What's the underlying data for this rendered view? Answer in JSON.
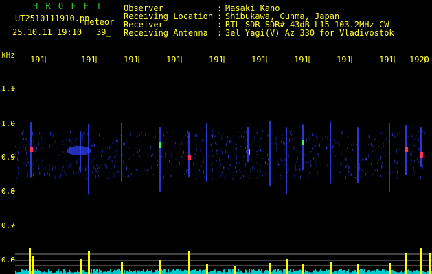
{
  "header": {
    "brand": "H R O F F T",
    "filename": "UT2510111910.pn",
    "suffix": "meteor",
    "datetime": "25.10.11 19:10",
    "number": "39_",
    "fields": [
      {
        "label": "Observer",
        "value": "Masaki Kano"
      },
      {
        "label": "Receiving Location",
        "value": "Shibukawa, Gunma, Japan"
      },
      {
        "label": "Receiver",
        "value": "RTL-SDR SDR# 43dB L15 103.2MHz CW"
      },
      {
        "label": "Receiving Antenna",
        "value": "3el Yagi(V) Az 330 for Vladivostok"
      }
    ],
    "colon": ":"
  },
  "axis": {
    "unit": "kHz",
    "y_ticks": [
      "1.1",
      "1.0",
      "0.9",
      "0.8",
      "0.7",
      "0.6"
    ],
    "x_ticks": [
      "191",
      "191",
      "191",
      "191",
      "191",
      "191",
      "191",
      "191",
      "191",
      "1920"
    ]
  },
  "colors": {
    "text_yellow": "#ffff33",
    "brand_green": "#33cc33",
    "background": "#000000",
    "signal": "#3344ff",
    "echo_hot": "#ff3366",
    "echo_green": "#33ff66",
    "bar": "#ffff00",
    "noise": "#00cccc"
  }
}
